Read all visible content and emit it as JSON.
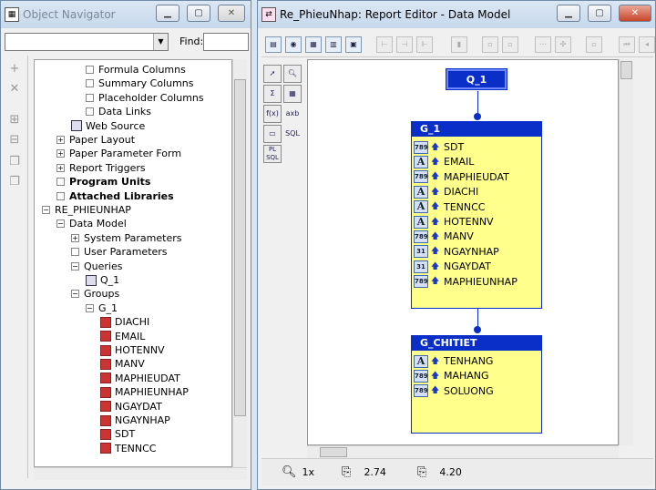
{
  "navigator": {
    "title": "Object Navigator",
    "find_label": "Find:",
    "tree": [
      {
        "label": "Formula Columns",
        "depth": 4,
        "kind": "box",
        "bold": false
      },
      {
        "label": "Summary Columns",
        "depth": 4,
        "kind": "box",
        "bold": false
      },
      {
        "label": "Placeholder Columns",
        "depth": 4,
        "kind": "box",
        "bold": false
      },
      {
        "label": "Data Links",
        "depth": 4,
        "kind": "box",
        "bold": false
      },
      {
        "label": "Web Source",
        "depth": 3,
        "kind": "none",
        "bold": false
      },
      {
        "label": "Paper Layout",
        "depth": 2,
        "kind": "plus",
        "bold": false
      },
      {
        "label": "Paper Parameter Form",
        "depth": 2,
        "kind": "plus",
        "bold": false
      },
      {
        "label": "Report Triggers",
        "depth": 2,
        "kind": "plus",
        "bold": false
      },
      {
        "label": "Program Units",
        "depth": 2,
        "kind": "box",
        "bold": true
      },
      {
        "label": "Attached Libraries",
        "depth": 2,
        "kind": "box",
        "bold": true
      },
      {
        "label": "RE_PHIEUNHAP",
        "depth": 1,
        "kind": "minus",
        "bold": false
      },
      {
        "label": "Data Model",
        "depth": 2,
        "kind": "minus",
        "bold": false
      },
      {
        "label": "System Parameters",
        "depth": 3,
        "kind": "plus",
        "bold": false
      },
      {
        "label": "User Parameters",
        "depth": 3,
        "kind": "box",
        "bold": false
      },
      {
        "label": "Queries",
        "depth": 3,
        "kind": "minus",
        "bold": false
      },
      {
        "label": "Q_1",
        "depth": 4,
        "kind": "none",
        "bold": false
      },
      {
        "label": "Groups",
        "depth": 3,
        "kind": "minus",
        "bold": false
      },
      {
        "label": "G_1",
        "depth": 4,
        "kind": "minus",
        "bold": false
      },
      {
        "label": "DIACHI",
        "depth": 5,
        "kind": "col",
        "bold": false
      },
      {
        "label": "EMAIL",
        "depth": 5,
        "kind": "col",
        "bold": false
      },
      {
        "label": "HOTENNV",
        "depth": 5,
        "kind": "col",
        "bold": false
      },
      {
        "label": "MANV",
        "depth": 5,
        "kind": "col",
        "bold": false
      },
      {
        "label": "MAPHIEUDAT",
        "depth": 5,
        "kind": "col",
        "bold": false
      },
      {
        "label": "MAPHIEUNHAP",
        "depth": 5,
        "kind": "col",
        "bold": false
      },
      {
        "label": "NGAYDAT",
        "depth": 5,
        "kind": "col",
        "bold": false
      },
      {
        "label": "NGAYNHAP",
        "depth": 5,
        "kind": "col",
        "bold": false
      },
      {
        "label": "SDT",
        "depth": 5,
        "kind": "col",
        "bold": false
      },
      {
        "label": "TENNCC",
        "depth": 5,
        "kind": "col",
        "bold": false
      }
    ]
  },
  "editor": {
    "title": "Re_PhieuNhap: Report Editor - Data Model",
    "query_label": "Q_1",
    "palette": [
      "",
      "",
      "Σ",
      "",
      "f(x)",
      "axb",
      "",
      "SQL",
      "PL SQL"
    ],
    "group1": {
      "name": "G_1",
      "columns": [
        {
          "type": "789",
          "name": "SDT"
        },
        {
          "type": "A",
          "name": "EMAIL"
        },
        {
          "type": "789",
          "name": "MAPHIEUDAT"
        },
        {
          "type": "A",
          "name": "DIACHI"
        },
        {
          "type": "A",
          "name": "TENNCC"
        },
        {
          "type": "A",
          "name": "HOTENNV"
        },
        {
          "type": "789",
          "name": "MANV"
        },
        {
          "type": "31",
          "name": "NGAYNHAP"
        },
        {
          "type": "31",
          "name": "NGAYDAT"
        },
        {
          "type": "789",
          "name": "MAPHIEUNHAP"
        }
      ]
    },
    "group2": {
      "name": "G_CHITIET",
      "columns": [
        {
          "type": "A",
          "name": "TENHANG"
        },
        {
          "type": "789",
          "name": "MAHANG"
        },
        {
          "type": "789",
          "name": "SOLUONG"
        }
      ]
    },
    "status": {
      "zoom": "1x",
      "x": "2.74",
      "y": "4.20"
    }
  }
}
